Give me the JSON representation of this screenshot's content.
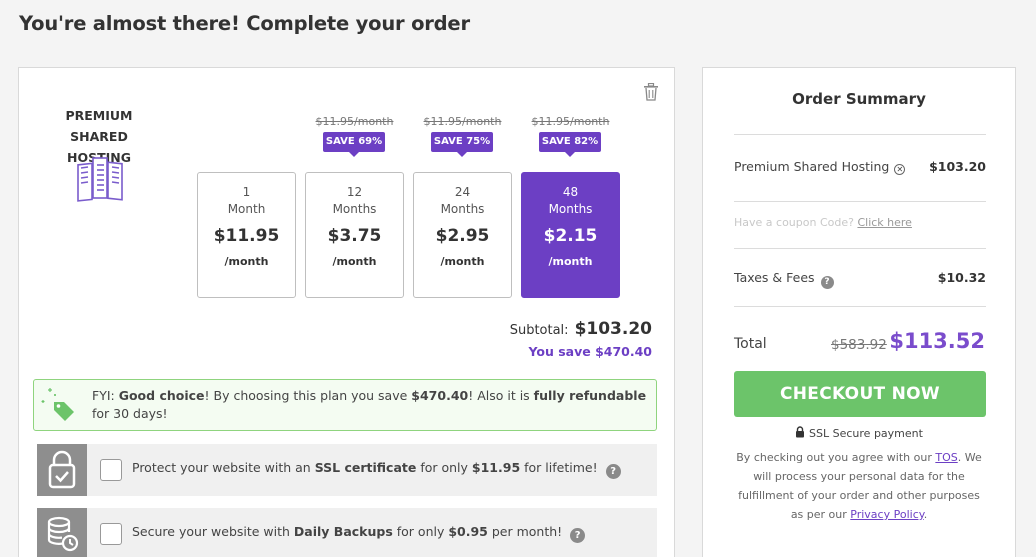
{
  "page": {
    "title": "You're almost there! Complete your order"
  },
  "plan": {
    "name": "PREMIUM SHARED HOSTING",
    "terms": [
      {
        "num": "1",
        "unit": "Month",
        "price": "$11.95",
        "per": "/month",
        "original": "",
        "save": ""
      },
      {
        "num": "12",
        "unit": "Months",
        "price": "$3.75",
        "per": "/month",
        "original": "$11.95/month",
        "save": "SAVE 69%"
      },
      {
        "num": "24",
        "unit": "Months",
        "price": "$2.95",
        "per": "/month",
        "original": "$11.95/month",
        "save": "SAVE 75%"
      },
      {
        "num": "48",
        "unit": "Months",
        "price": "$2.15",
        "per": "/month",
        "original": "$11.95/month",
        "save": "SAVE 82%"
      }
    ],
    "selected_term_index": 3,
    "subtotal_label": "Subtotal:",
    "subtotal_value": "$103.20",
    "you_save": "You save $470.40"
  },
  "fyi": {
    "p1": "FYI: ",
    "b1": "Good choice",
    "p2": "! By choosing this plan you save ",
    "b2": "$470.40",
    "p3": "! Also it is ",
    "b3": "fully refundable",
    "p4": " for 30 days!"
  },
  "upsells": [
    {
      "p1": "Protect your website with an ",
      "b1": "SSL certificate",
      "p2": " for only ",
      "b2": "$11.95",
      "p3": " for lifetime!",
      "help": "?"
    },
    {
      "p1": "Secure your website with ",
      "b1": "Daily Backups",
      "p2": " for only ",
      "b2": "$0.95",
      "p3": " per month!",
      "help": "?"
    }
  ],
  "summary": {
    "title": "Order Summary",
    "item_label": "Premium Shared Hosting",
    "item_value": "$103.20",
    "coupon_text": "Have a coupon Code?",
    "coupon_link": "Click here",
    "taxes_label": "Taxes & Fees",
    "taxes_value": "$10.32",
    "help": "?",
    "total_label": "Total",
    "total_original": "$583.92",
    "total_value": "$113.52",
    "checkout_label": "CHECKOUT NOW",
    "ssl_label": "SSL Secure payment",
    "legal_p1": "By checking out you agree with our ",
    "legal_tos": "TOS",
    "legal_p2": ". We will process your personal data for the fulfillment of your order and other purposes as per our ",
    "legal_privacy": "Privacy Policy",
    "legal_p3": "."
  },
  "colors": {
    "accent": "#6c3fc4",
    "checkout": "#6cc46a",
    "total": "#7a4ccc"
  },
  "icons": {
    "plan": "server-icon",
    "trash": "trash-icon",
    "fyi": "price-tag-icon",
    "ssl": "padlock-check-icon",
    "backup": "database-restore-icon",
    "lock": "lock-icon"
  }
}
